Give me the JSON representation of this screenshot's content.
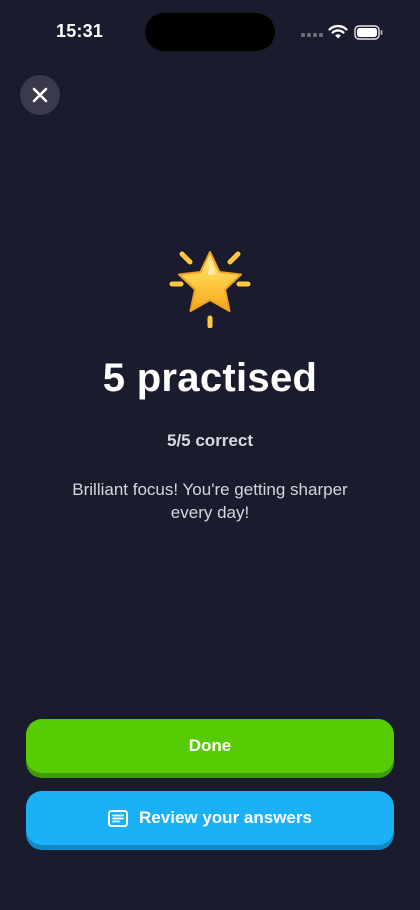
{
  "status_bar": {
    "time": "15:31"
  },
  "header": {
    "close_icon": "close-icon"
  },
  "result": {
    "icon": "glowing-star-icon",
    "title": "5 practised",
    "score": "5/5 correct",
    "message": "Brilliant focus! You're getting sharper every day!"
  },
  "actions": {
    "done_label": "Done",
    "review_label": "Review your answers",
    "review_icon": "document-icon"
  },
  "colors": {
    "background": "#1b1b2e",
    "done_green": "#58cc02",
    "review_blue": "#1cb0f6",
    "star_gold": "#ffc83d"
  }
}
